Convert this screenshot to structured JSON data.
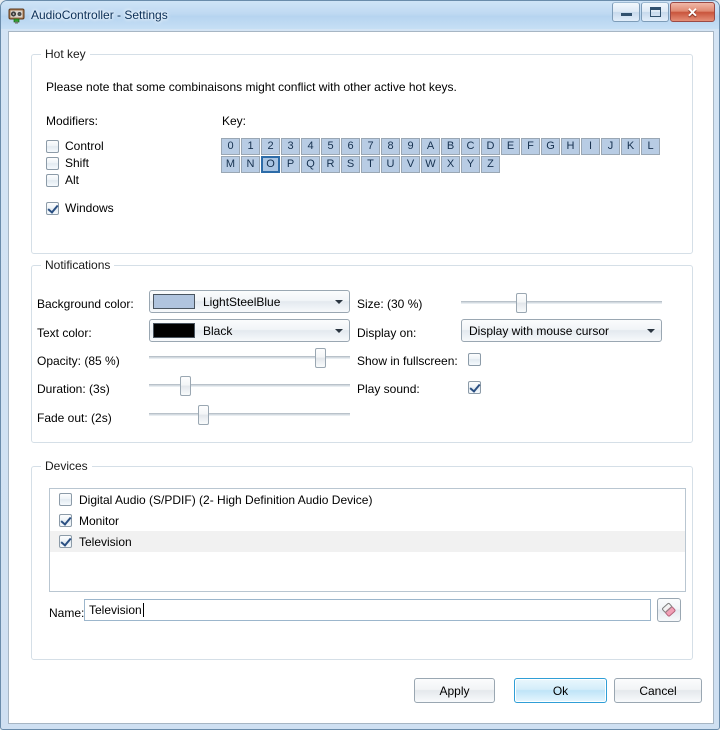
{
  "window": {
    "title": "AudioController - Settings",
    "icon": "audio-device-icon",
    "buttons": {
      "minimize": "minimize-icon",
      "maximize": "maximize-icon",
      "close": "✕"
    }
  },
  "hotkey": {
    "group_title": "Hot key",
    "note": "Please note that some combinaisons might conflict with other active hot keys.",
    "modifiers_label": "Modifiers:",
    "key_label": "Key:",
    "modifiers": [
      {
        "label": "Control",
        "checked": false
      },
      {
        "label": "Shift",
        "checked": false
      },
      {
        "label": "Alt",
        "checked": false
      },
      {
        "label": "Windows",
        "checked": true
      }
    ],
    "keys": [
      "0",
      "1",
      "2",
      "3",
      "4",
      "5",
      "6",
      "7",
      "8",
      "9",
      "A",
      "B",
      "C",
      "D",
      "E",
      "F",
      "G",
      "H",
      "I",
      "J",
      "K",
      "L",
      "M",
      "N",
      "O",
      "P",
      "Q",
      "R",
      "S",
      "T",
      "U",
      "V",
      "W",
      "X",
      "Y",
      "Z"
    ],
    "selected_key": "O"
  },
  "notifications": {
    "group_title": "Notifications",
    "background_color_label": "Background color:",
    "background_color_value": "LightSteelBlue",
    "background_color_hex": "#B0C4DE",
    "text_color_label": "Text color:",
    "text_color_value": "Black",
    "text_color_hex": "#000000",
    "opacity_label": "Opacity: (85 %)",
    "opacity_percent": 85,
    "duration_label": "Duration: (3s)",
    "duration_percent": 18,
    "fadeout_label": "Fade out: (2s)",
    "fadeout_percent": 27,
    "size_label": "Size: (30 %)",
    "size_percent": 30,
    "display_on_label": "Display on:",
    "display_on_value": "Display with mouse cursor",
    "show_fullscreen_label": "Show in fullscreen:",
    "show_fullscreen_checked": false,
    "play_sound_label": "Play sound:",
    "play_sound_checked": true
  },
  "devices": {
    "group_title": "Devices",
    "items": [
      {
        "label": "Digital Audio (S/PDIF) (2- High Definition Audio Device)",
        "checked": false,
        "selected": false
      },
      {
        "label": "Monitor",
        "checked": true,
        "selected": false
      },
      {
        "label": "Television",
        "checked": true,
        "selected": true
      }
    ],
    "name_label": "Name:",
    "name_value": "Television",
    "clear_icon": "eraser-icon"
  },
  "footer": {
    "apply": "Apply",
    "ok": "Ok",
    "cancel": "Cancel"
  }
}
